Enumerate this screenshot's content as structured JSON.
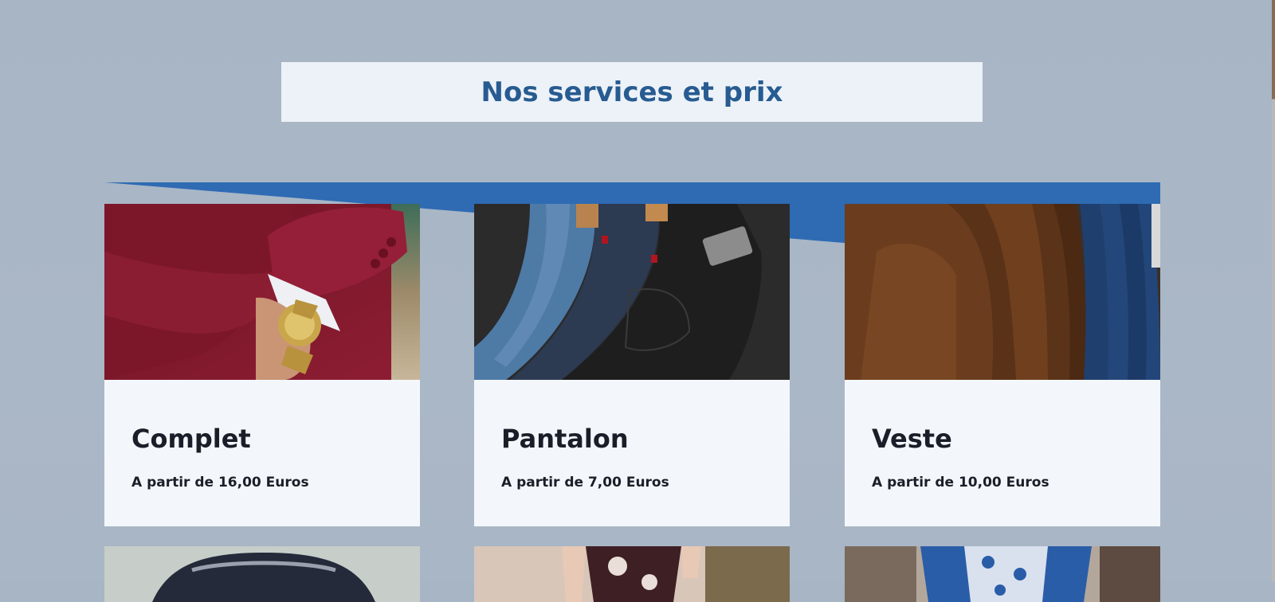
{
  "section": {
    "title": "Nos services et prix"
  },
  "colors": {
    "background": "#a9b6c5",
    "title_box": "#ecf2f7",
    "title_text": "#275b91",
    "accent_band": "#2e6bb3",
    "card_body": "#f3f7fb",
    "card_text": "#1a1e28"
  },
  "services": [
    {
      "name": "Complet",
      "price": "A partir de 16,00 Euros",
      "image": "burgundy-suit-with-gold-watch"
    },
    {
      "name": "Pantalon",
      "price": "A partir de 7,00 Euros",
      "image": "folded-jeans"
    },
    {
      "name": "Veste",
      "price": "A partir de 10,00 Euros",
      "image": "jackets-on-rack"
    }
  ],
  "next_row_images": [
    "knit-sweater",
    "floral-dress",
    "blue-patterned-dress"
  ]
}
